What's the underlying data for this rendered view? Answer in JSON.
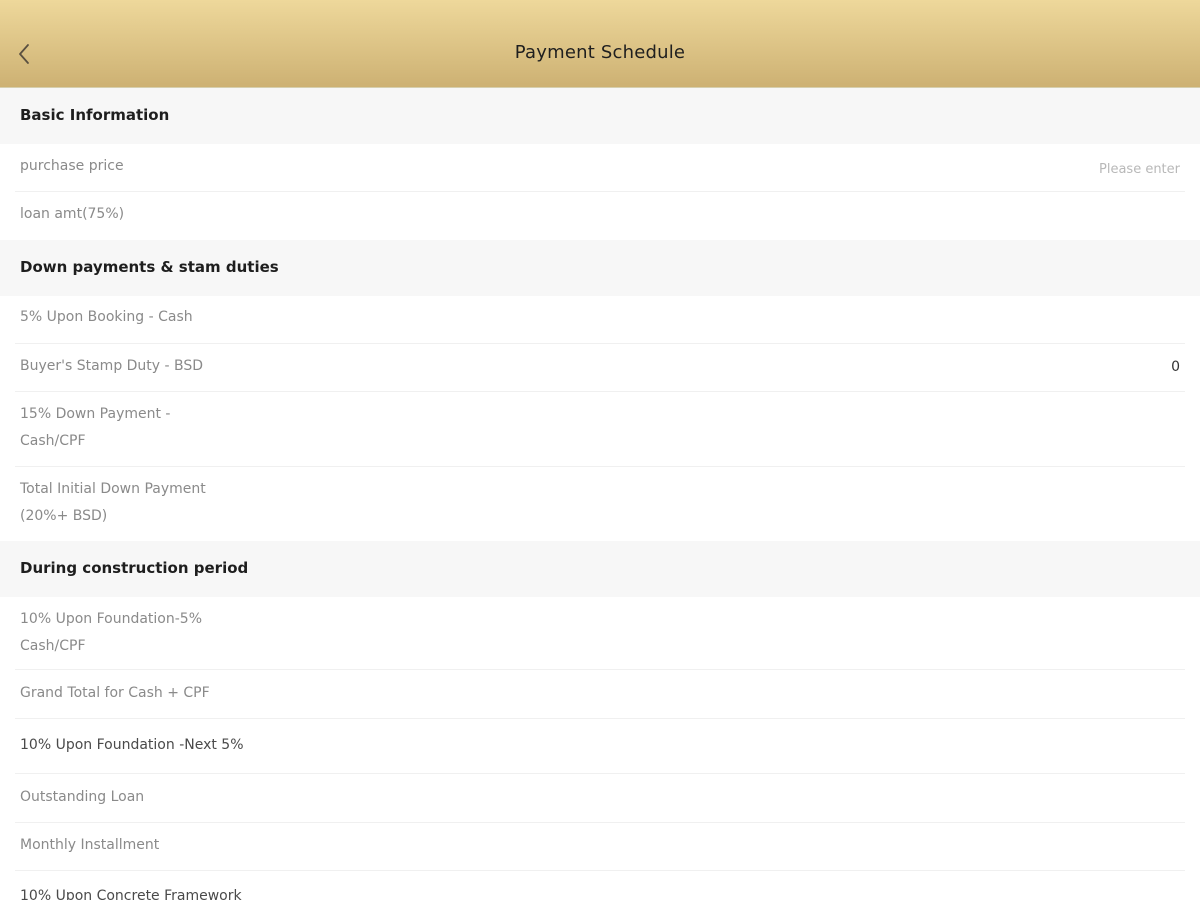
{
  "header": {
    "title": "Payment Schedule"
  },
  "sections": [
    {
      "title": "Basic Information",
      "rows": [
        {
          "label": "purchase price",
          "placeholder": "Please enter"
        },
        {
          "label": "loan amt(75%)"
        }
      ]
    },
    {
      "title": "Down payments & stam duties",
      "rows": [
        {
          "label": "5% Upon Booking - Cash"
        },
        {
          "label": "Buyer's Stamp Duty - BSD",
          "value": "0"
        },
        {
          "label_line1": "15% Down Payment -",
          "label_line2": "Cash/CPF"
        },
        {
          "label_line1": "Total Initial Down Payment",
          "label_line2": "(20%+ BSD)"
        }
      ]
    },
    {
      "title": "During construction period",
      "rows": [
        {
          "label_line1": "10% Upon Foundation-5%",
          "label_line2": "Cash/CPF"
        },
        {
          "label": "Grand Total for Cash + CPF"
        },
        {
          "label": "10% Upon Foundation -Next 5%"
        },
        {
          "label": "Outstanding Loan"
        },
        {
          "label": "Monthly Installment"
        },
        {
          "label": "10% Upon Concrete Framework"
        }
      ]
    }
  ]
}
